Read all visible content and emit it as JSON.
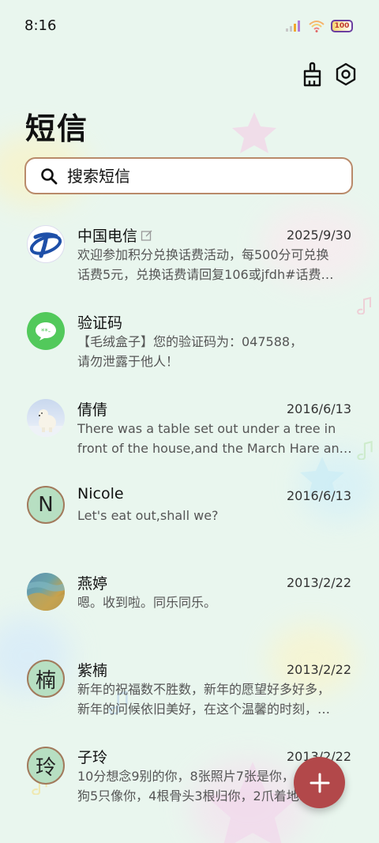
{
  "status_bar": {
    "time": "8:16",
    "battery": "100"
  },
  "header": {
    "title": "短信"
  },
  "icons": {
    "clean": "broom-icon",
    "settings": "gear-icon",
    "search": "search-icon",
    "compose": "plus-icon"
  },
  "search": {
    "placeholder": "搜索短信"
  },
  "colors": {
    "accent": "#b2484a",
    "background": "#e9f6ee",
    "search_border": "#b98a6a"
  },
  "conversations": [
    {
      "name": "中国电信",
      "date": "2025/9/30",
      "avatar": "china-telecom-logo",
      "edit_icon": true,
      "lines": [
        "欢迎参加积分兑换话费活动，每500分可兑换",
        "话费5元，兑换话费请回复106或jfdh#话费…"
      ]
    },
    {
      "name": "验证码",
      "date": "",
      "avatar": "message-bubble-icon",
      "lines": [
        "【毛绒盒子】您的验证码为：047588，",
        "请勿泄露于他人！"
      ]
    },
    {
      "name": "倩倩",
      "date": "2016/6/13",
      "avatar": "polar-bear-photo",
      "lines": [
        "There was a table set out under a tree in",
        "front of the house,and the March Hare an…"
      ]
    },
    {
      "name": "Nicole",
      "date": "2016/6/13",
      "avatar_letter": "N",
      "lines": [
        "Let's eat out,shall we?"
      ]
    },
    {
      "name": "燕婷",
      "date": "2013/2/22",
      "avatar": "landscape-photo",
      "lines": [
        "嗯。收到啦。同乐同乐。"
      ]
    },
    {
      "name": "紫楠",
      "date": "2013/2/22",
      "avatar_letter": "楠",
      "lines": [
        "新年的祝福数不胜数，新年的愿望好多好多，",
        "新年的问候依旧美好，在这个温馨的时刻，…"
      ]
    },
    {
      "name": "子玲",
      "date": "2013/2/22",
      "avatar_letter": "玲",
      "lines": [
        "10分想念9别的你，8张照片7张是你，6只小",
        "狗5只像你，4根骨头3根归你，2爪着地1定…"
      ]
    }
  ]
}
